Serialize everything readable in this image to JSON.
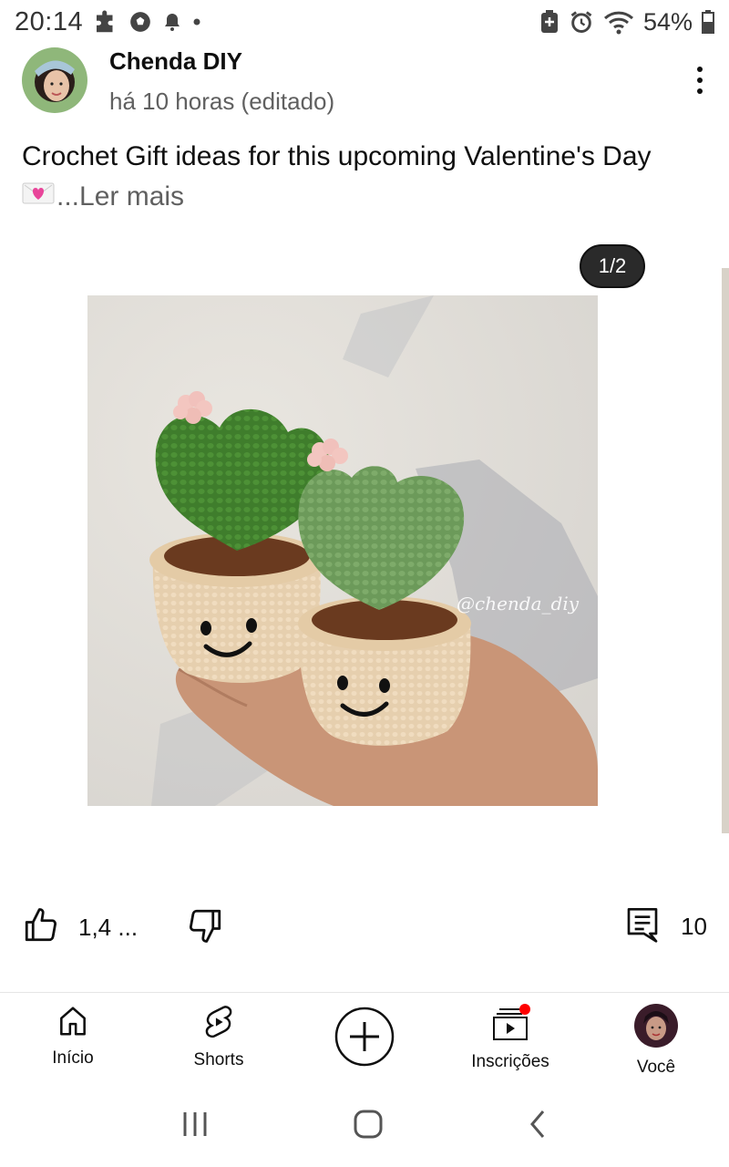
{
  "status_bar": {
    "time": "20:14",
    "battery": "54%",
    "left_icons": [
      "puzzle-icon",
      "soccer-ball-icon",
      "bell-icon",
      "dot-icon"
    ],
    "right_icons": [
      "battery-saver-icon",
      "alarm-icon",
      "wifi-icon",
      "battery-icon"
    ]
  },
  "post": {
    "channel_name": "Chenda DIY",
    "time": "há 10 horas (editado)",
    "text": "Crochet Gift ideas for this upcoming Valentine's Day",
    "emoji": "💗",
    "read_more": "...Ler mais",
    "page_indicator": "1/2",
    "watermark": "@chenda_diy",
    "likes": "1,4 ...",
    "comments": "10"
  },
  "bottom_nav": {
    "items": [
      {
        "label": "Início",
        "icon": "home-icon"
      },
      {
        "label": "Shorts",
        "icon": "shorts-icon"
      },
      {
        "label": "",
        "icon": "create-icon"
      },
      {
        "label": "Inscrições",
        "icon": "subscriptions-icon"
      },
      {
        "label": "Você",
        "icon": "avatar"
      }
    ]
  },
  "system_nav": [
    "recents-icon",
    "home-button-icon",
    "back-icon"
  ],
  "colors": {
    "text_primary": "#0f0f0f",
    "text_secondary": "#606060",
    "notification_dot": "#ff0000"
  }
}
